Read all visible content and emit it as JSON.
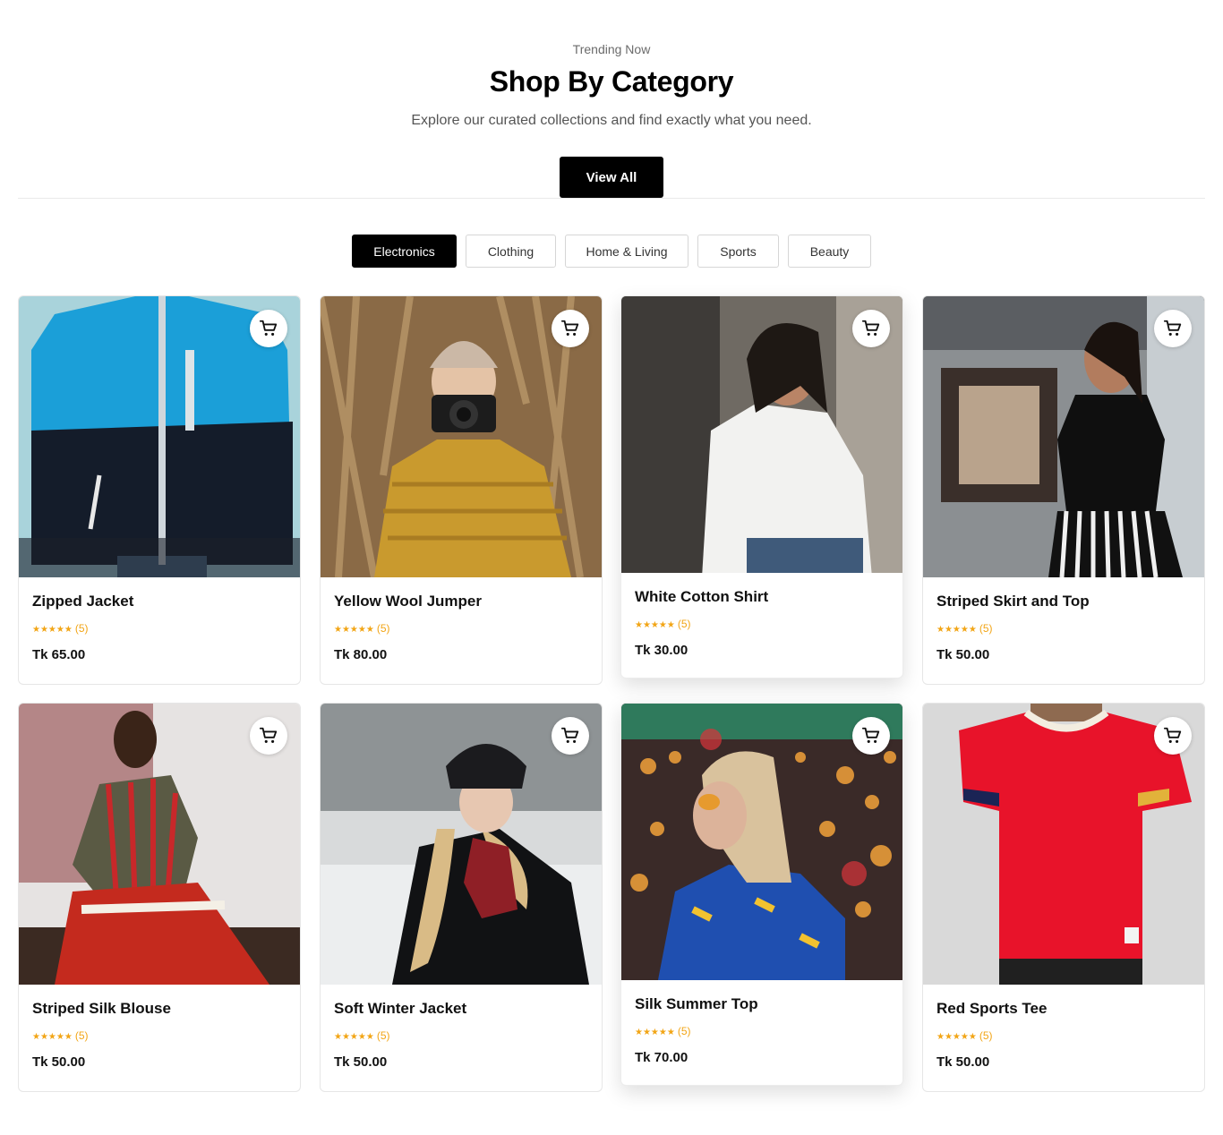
{
  "section": {
    "eyebrow": "Trending Now",
    "title": "Shop By Category",
    "subtitle": "Explore our curated collections and find exactly what you need.",
    "view_all_label": "View All"
  },
  "tabs": [
    {
      "label": "Electronics",
      "active": true
    },
    {
      "label": "Clothing",
      "active": false
    },
    {
      "label": "Home & Living",
      "active": false
    },
    {
      "label": "Sports",
      "active": false
    },
    {
      "label": "Beauty",
      "active": false
    }
  ],
  "products": [
    {
      "name": "Zipped Jacket",
      "stars": "★★★★★",
      "reviews": "(5)",
      "price": "Tk 65.00",
      "icon": "cart-icon"
    },
    {
      "name": "Yellow Wool Jumper",
      "stars": "★★★★★",
      "reviews": "(5)",
      "price": "Tk 80.00",
      "icon": "cart-icon"
    },
    {
      "name": "White Cotton Shirt",
      "stars": "★★★★★",
      "reviews": "(5)",
      "price": "Tk 30.00",
      "icon": "cart-icon"
    },
    {
      "name": "Striped Skirt and Top",
      "stars": "★★★★★",
      "reviews": "(5)",
      "price": "Tk 50.00",
      "icon": "cart-icon"
    },
    {
      "name": "Striped Silk Blouse",
      "stars": "★★★★★",
      "reviews": "(5)",
      "price": "Tk 50.00",
      "icon": "cart-icon"
    },
    {
      "name": "Soft Winter Jacket",
      "stars": "★★★★★",
      "reviews": "(5)",
      "price": "Tk 50.00",
      "icon": "cart-icon"
    },
    {
      "name": "Silk Summer Top",
      "stars": "★★★★★",
      "reviews": "(5)",
      "price": "Tk 70.00",
      "icon": "cart-icon"
    },
    {
      "name": "Red Sports Tee",
      "stars": "★★★★★",
      "reviews": "(5)",
      "price": "Tk 50.00",
      "icon": "cart-icon"
    }
  ],
  "colors": {
    "accent": "#000000",
    "star": "#f2a516",
    "border": "#e6e6e6"
  }
}
